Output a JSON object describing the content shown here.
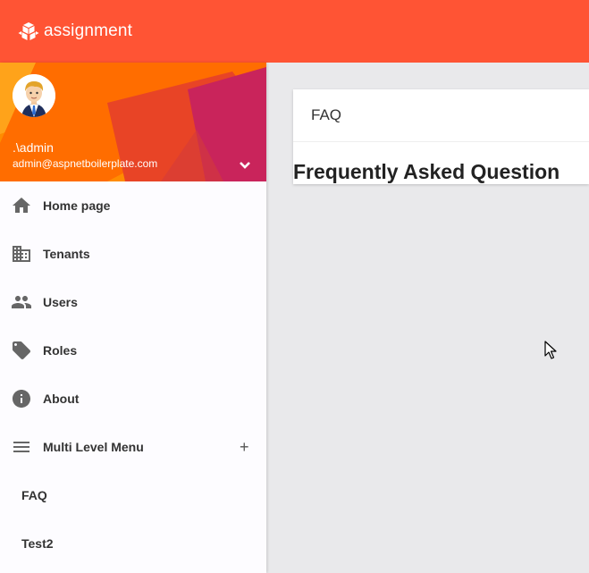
{
  "app": {
    "title": "assignment",
    "brand_color": "#ff5434"
  },
  "user": {
    "name": ".\\admin",
    "email": "admin@aspnetboilerplate.com"
  },
  "sidebar": {
    "items": [
      {
        "label": "Home page",
        "icon": "home-icon"
      },
      {
        "label": "Tenants",
        "icon": "building-icon"
      },
      {
        "label": "Users",
        "icon": "people-icon"
      },
      {
        "label": "Roles",
        "icon": "tag-icon"
      },
      {
        "label": "About",
        "icon": "info-icon"
      },
      {
        "label": "Multi Level Menu",
        "icon": "menu-icon",
        "expand": "+"
      },
      {
        "label": "FAQ"
      },
      {
        "label": "Test2"
      }
    ]
  },
  "main": {
    "card_title": "FAQ",
    "heading": "Frequently Asked Question"
  }
}
